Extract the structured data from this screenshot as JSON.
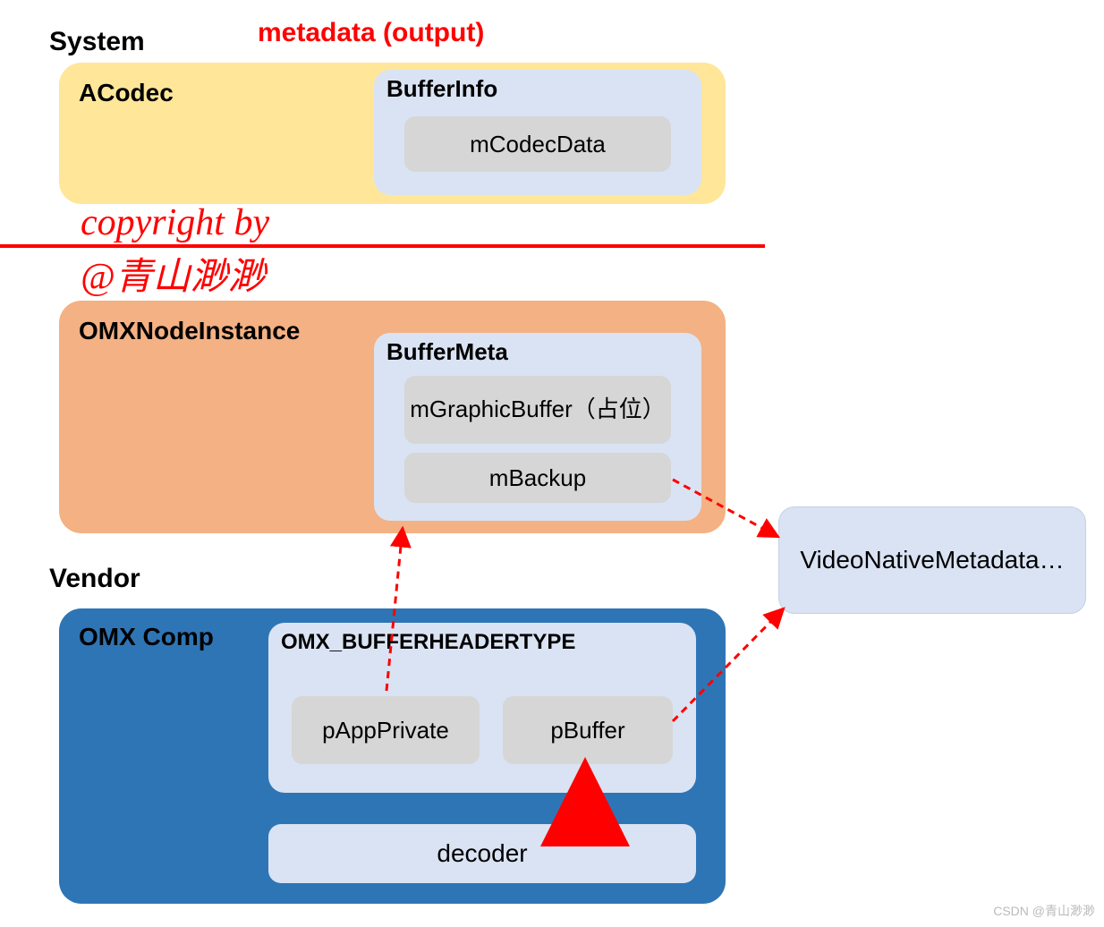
{
  "header": {
    "system_label": "System",
    "vendor_label": "Vendor",
    "title": "metadata (output)"
  },
  "copyright": {
    "line1": "copyright by",
    "line2": "@青山渺渺"
  },
  "acodec": {
    "title": "ACodec",
    "bufferinfo": {
      "title": "BufferInfo",
      "field": "mCodecData"
    }
  },
  "omxnode": {
    "title": "OMXNodeInstance",
    "buffermeta": {
      "title": "BufferMeta",
      "field1": "mGraphicBuffer（占位）",
      "field2": "mBackup"
    }
  },
  "omxcomp": {
    "title": "OMX Comp",
    "header": {
      "title": "OMX_BUFFERHEADERTYPE",
      "field1": "pAppPrivate",
      "field2": "pBuffer"
    },
    "decoder": "decoder"
  },
  "video_native": "VideoNativeMetadata…",
  "watermark": "CSDN @青山渺渺"
}
